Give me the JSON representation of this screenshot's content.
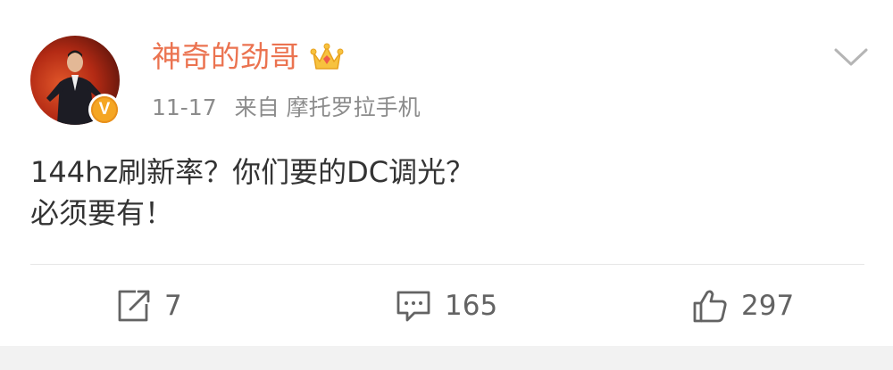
{
  "post": {
    "author": {
      "name": "神奇的劲哥",
      "crown_icon": "crown-icon",
      "verified_badge": "V",
      "avatar_icon": "avatar-photo"
    },
    "meta": {
      "date": "11-17",
      "source": "来自 摩托罗拉手机"
    },
    "content": {
      "lines": [
        "144hz刷新率？你们要的DC调光？",
        "必须要有！"
      ]
    },
    "actions": {
      "repost_count": "7",
      "comment_count": "165",
      "like_count": "297"
    }
  },
  "colors": {
    "username": "#eb7350",
    "meta": "#8c8c8c",
    "body_text": "#333333",
    "action_text": "#636363",
    "verified_badge": "#f5a623",
    "divider": "#e6e6e6",
    "bottom_strip": "#f2f2f2"
  },
  "icons": {
    "menu": "chevron-down-icon",
    "repost": "repost-icon",
    "comment": "comment-icon",
    "like": "thumbs-up-icon"
  }
}
